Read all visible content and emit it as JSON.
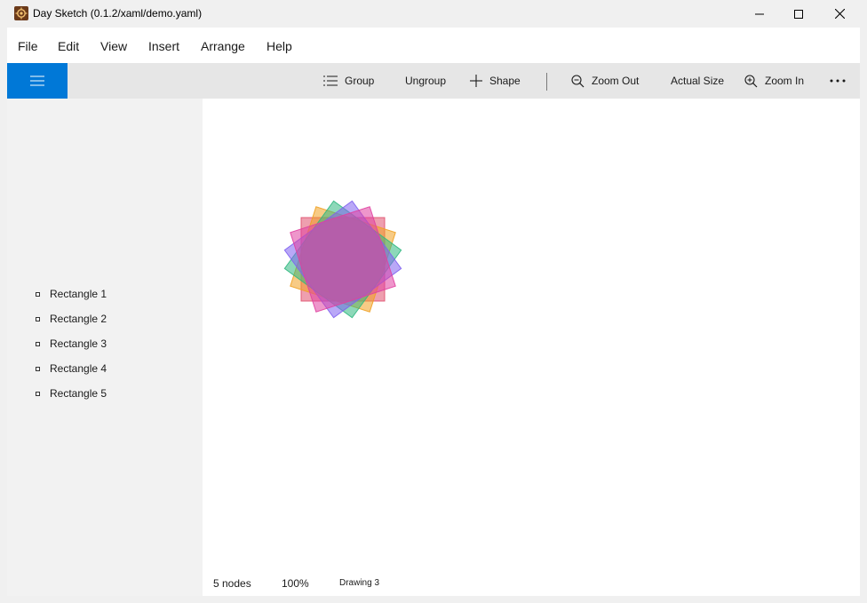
{
  "window": {
    "title": "Day Sketch (0.1.2/xaml/demo.yaml)"
  },
  "menu": {
    "items": [
      "File",
      "Edit",
      "View",
      "Insert",
      "Arrange",
      "Help"
    ]
  },
  "toolbar": {
    "group_label": "Group",
    "ungroup_label": "Ungroup",
    "shape_label": "Shape",
    "zoom_out_label": "Zoom Out",
    "actual_size_label": "Actual Size",
    "zoom_in_label": "Zoom In",
    "accent_color": "#0078d7"
  },
  "sidebar": {
    "items": [
      {
        "label": "Rectangle 1"
      },
      {
        "label": "Rectangle 2"
      },
      {
        "label": "Rectangle 3"
      },
      {
        "label": "Rectangle 4"
      },
      {
        "label": "Rectangle 5"
      }
    ]
  },
  "drawing": {
    "shapes": [
      {
        "name": "Rectangle 1",
        "fill": "#e0506e",
        "rotation_deg": 0
      },
      {
        "name": "Rectangle 2",
        "fill": "#f0a020",
        "rotation_deg": 18
      },
      {
        "name": "Rectangle 3",
        "fill": "#30b880",
        "rotation_deg": 36
      },
      {
        "name": "Rectangle 4",
        "fill": "#8060f0",
        "rotation_deg": 54
      },
      {
        "name": "Rectangle 5",
        "fill": "#e040a0",
        "rotation_deg": 72
      }
    ]
  },
  "status": {
    "nodes": "5 nodes",
    "zoom": "100%",
    "document": "Drawing 3"
  }
}
